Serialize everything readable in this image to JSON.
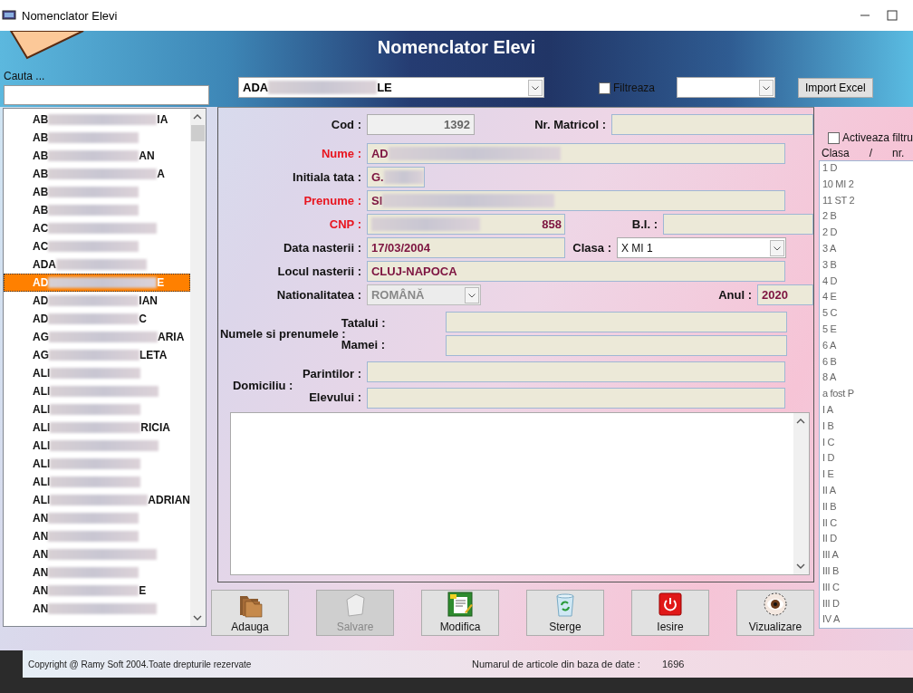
{
  "window": {
    "title": "Nomenclator Elevi"
  },
  "header": {
    "title": "Nomenclator Elevi"
  },
  "search": {
    "label": "Cauta ..."
  },
  "student_combo": {
    "prefix": "ADA",
    "suffix": "LE"
  },
  "filter": {
    "label": "Filtreaza",
    "checked": false
  },
  "import_button": {
    "label": "Import Excel"
  },
  "students": [
    {
      "prefix": "AB",
      "suffix": "IA",
      "selected": false
    },
    {
      "prefix": "AB",
      "selected": false
    },
    {
      "prefix": "AB",
      "suffix": "AN",
      "selected": false
    },
    {
      "prefix": "AB",
      "suffix": "A",
      "selected": false
    },
    {
      "prefix": "AB",
      "selected": false
    },
    {
      "prefix": "AB",
      "selected": false
    },
    {
      "prefix": "AC",
      "selected": false
    },
    {
      "prefix": "AC",
      "selected": false
    },
    {
      "prefix": "ADA",
      "selected": false
    },
    {
      "prefix": "AD",
      "suffix": "E",
      "selected": true
    },
    {
      "prefix": "AD",
      "suffix": "IAN",
      "selected": false
    },
    {
      "prefix": "AD",
      "suffix": "C",
      "selected": false
    },
    {
      "prefix": "AG",
      "suffix": "ARIA",
      "selected": false
    },
    {
      "prefix": "AG",
      "suffix": "LETA",
      "selected": false
    },
    {
      "prefix": "ALI",
      "selected": false
    },
    {
      "prefix": "ALI",
      "selected": false
    },
    {
      "prefix": "ALI",
      "selected": false
    },
    {
      "prefix": "ALI",
      "suffix": "RICIA",
      "selected": false
    },
    {
      "prefix": "ALI",
      "selected": false
    },
    {
      "prefix": "ALI",
      "selected": false
    },
    {
      "prefix": "ALI",
      "selected": false
    },
    {
      "prefix": "ALI",
      "suffix": "ADRIAN",
      "selected": false
    },
    {
      "prefix": "AN",
      "selected": false
    },
    {
      "prefix": "AN",
      "selected": false
    },
    {
      "prefix": "AN",
      "selected": false
    },
    {
      "prefix": "AN",
      "selected": false
    },
    {
      "prefix": "AN",
      "suffix": "E",
      "selected": false
    },
    {
      "prefix": "AN",
      "selected": false
    }
  ],
  "form": {
    "cod": {
      "label": "Cod :",
      "value": "1392"
    },
    "nr_matricol": {
      "label": "Nr. Matricol :"
    },
    "nume": {
      "label": "Nume :",
      "required": true,
      "prefix": "AD"
    },
    "initiala_tata": {
      "label": "Initiala tata :",
      "required": false,
      "prefix": "G."
    },
    "prenume": {
      "label": "Prenume :",
      "required": true,
      "prefix": "SI"
    },
    "cnp": {
      "label": "CNP :",
      "required": true,
      "suffix": "858"
    },
    "bi": {
      "label": "B.I. :"
    },
    "data_nasterii": {
      "label": "Data nasterii :",
      "required": false,
      "value": "17/03/2004"
    },
    "clasa": {
      "label": "Clasa :",
      "value": "X MI 1"
    },
    "locul_nasterii": {
      "label": "Locul nasterii :",
      "required": false,
      "value": "CLUJ-NAPOCA"
    },
    "nationalitatea": {
      "label": "Nationalitatea :",
      "required": false,
      "value": "ROMÂNĂ",
      "disabled": true
    },
    "anul": {
      "label": "Anul :",
      "value": "2020"
    },
    "parinti": {
      "label": "Numele si prenumele :",
      "tatalui": "Tatalui :",
      "mamei": "Mamei :"
    },
    "domiciliu": {
      "label": "Domiciliu :",
      "parintilor": "Parintilor :",
      "elevului": "Elevului :"
    }
  },
  "buttons": [
    {
      "label": "Adauga",
      "kind": "folders",
      "disabled": false
    },
    {
      "label": "Salvare",
      "kind": "blank",
      "disabled": true
    },
    {
      "label": "Modifica",
      "kind": "edit",
      "disabled": false
    },
    {
      "label": "Sterge",
      "kind": "recycle",
      "disabled": false
    },
    {
      "label": "Iesire",
      "kind": "power",
      "disabled": false
    },
    {
      "label": "Vizualizare",
      "kind": "eye",
      "disabled": false
    }
  ],
  "class_filter": {
    "label": "Activeaza filtru",
    "checked": false
  },
  "class_list": {
    "columns": [
      "Clasa",
      "/",
      "nr."
    ],
    "items": [
      "1 D",
      "10 MI 2",
      "11 ST 2",
      "2 B",
      "2 D",
      "3 A",
      "3 B",
      "4 D",
      "4 E",
      "5 C",
      "5 E",
      "6 A",
      "6 B",
      "8 A",
      "a fost P",
      "I A",
      "I B",
      "I C",
      "I D",
      "I E",
      "II A",
      "II B",
      "II C",
      "II D",
      "III A",
      "III B",
      "III C",
      "III D",
      "IV A"
    ]
  },
  "footer": {
    "copyright": "Copyright @ Ramy Soft 2004.Toate drepturile rezervate",
    "count_label": "Numarul de articole din baza de date :",
    "count": "1696"
  }
}
